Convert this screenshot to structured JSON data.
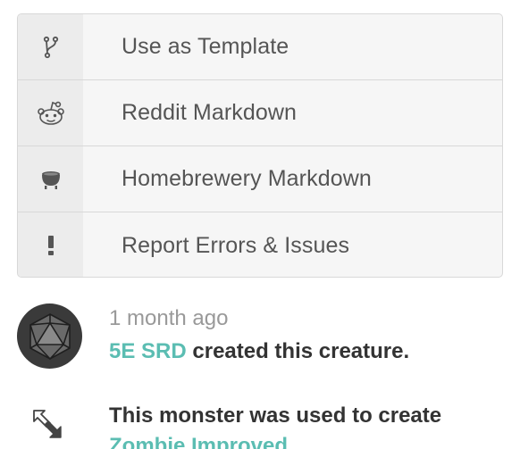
{
  "menu": {
    "items": [
      {
        "label": "Use as Template",
        "icon": "fork-icon"
      },
      {
        "label": "Reddit Markdown",
        "icon": "reddit-icon"
      },
      {
        "label": "Homebrewery Markdown",
        "icon": "cauldron-icon"
      },
      {
        "label": "Report Errors & Issues",
        "icon": "exclamation-icon"
      }
    ]
  },
  "activity": {
    "time": "1 month ago",
    "author": "5E SRD",
    "action": "created this creature.",
    "avatar_icon": "d20-icon"
  },
  "derived": {
    "text": "This monster was used to create",
    "link": "Zombie Improved",
    "icon": "arrows-icon"
  },
  "colors": {
    "link": "#5bbdb2",
    "muted": "#999999",
    "text": "#333333"
  }
}
